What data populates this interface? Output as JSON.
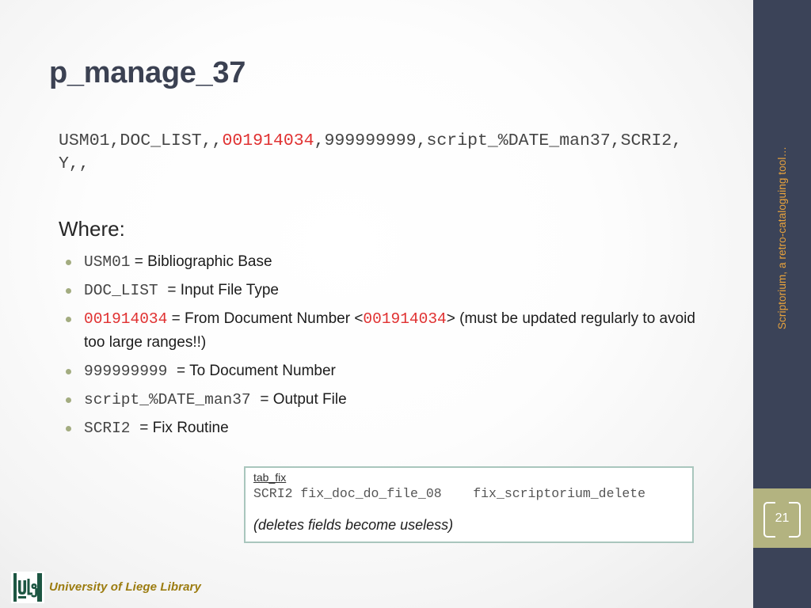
{
  "slide": {
    "title": "p_manage_37",
    "page_number": "21",
    "sidebar_label": "Scriptorium, a retro-cataloguing tool…",
    "colors": {
      "sidebar_bg": "#3b4358",
      "sidebar_text": "#e8a33d",
      "badge_bg": "#b3b380",
      "title": "#3b4152",
      "accent_red": "#e03131",
      "bullet": "#a3ac80",
      "box_border": "#a9c6bd",
      "footer_text": "#9c7c10",
      "logo_green": "#1d5642"
    }
  },
  "code_line": {
    "part1": "USM01,DOC_LIST,,",
    "highlight": "001914034",
    "part2": ",999999999,script_%DATE_man37,SCRI2,Y,,"
  },
  "where": {
    "heading": "Where:",
    "items": [
      {
        "code": "USM01",
        "code_color": "gray",
        "label": " = Bibliographic Base",
        "extra": "",
        "extra2": ""
      },
      {
        "code": "DOC_LIST ",
        "code_color": "gray",
        "label": " = Input File Type",
        "extra": "",
        "extra2": ""
      },
      {
        "code": "001914034",
        "code_color": "red",
        "label": " = From Document Number <",
        "extra": "001914034",
        "extra2": "> (must be updated regularly to avoid too large ranges!!)"
      },
      {
        "code": "999999999 ",
        "code_color": "gray",
        "label": " = To Document Number",
        "extra": "",
        "extra2": ""
      },
      {
        "code": "script_%DATE_man37 ",
        "code_color": "gray",
        "label": " = Output File",
        "extra": "",
        "extra2": ""
      },
      {
        "code": "SCRI2 ",
        "code_color": "gray",
        "label": " = Fix Routine",
        "extra": "",
        "extra2": ""
      }
    ]
  },
  "note_box": {
    "title": "tab_fix",
    "code": "SCRI2 fix_doc_do_file_08    fix_scriptorium_delete",
    "italic": "(deletes fields become useless)"
  },
  "footer": {
    "logo_text": "ULg",
    "text": "University of Liege Library"
  }
}
